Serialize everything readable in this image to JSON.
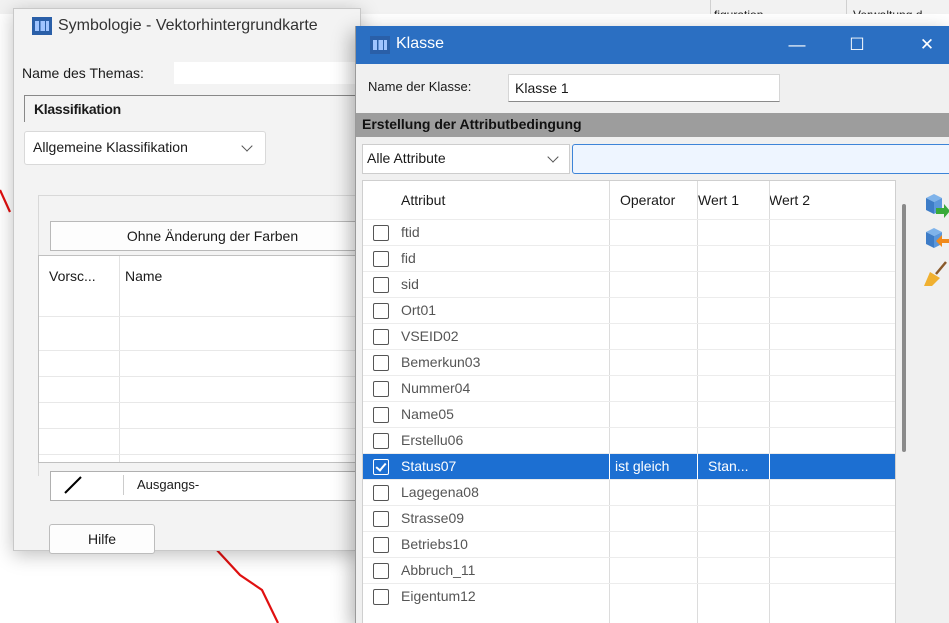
{
  "background": {
    "tab_partial_1": "figuration",
    "tab_partial_2": "Verwaltung d"
  },
  "symbology_window": {
    "title": "Symbologie - Vektorhintergrundkarte",
    "theme_label": "Name des Themas:",
    "classification_group": "Klassifikation",
    "classification_type": "Allgemeine Klassifikation",
    "color_button": "Ohne Änderung der Farben",
    "list_headers": [
      "Vorsc...",
      "Name"
    ],
    "symbol_label": "Ausgangs-",
    "help_button": "Hilfe"
  },
  "class_dialog": {
    "title": "Klasse",
    "name_label": "Name der Klasse:",
    "name_value": "Klasse 1",
    "section_title": "Erstellung der Attributbedingung",
    "attribute_filter": "Alle Attribute",
    "value_filter": "",
    "columns": [
      "Attribut",
      "Operator",
      "Wert 1",
      "Wert 2"
    ],
    "rows": [
      {
        "attr": "ftid",
        "op": "",
        "w1": "",
        "w2": "",
        "checked": false
      },
      {
        "attr": "fid",
        "op": "",
        "w1": "",
        "w2": "",
        "checked": false
      },
      {
        "attr": "sid",
        "op": "",
        "w1": "",
        "w2": "",
        "checked": false
      },
      {
        "attr": "Ort01",
        "op": "",
        "w1": "",
        "w2": "",
        "checked": false
      },
      {
        "attr": "VSEID02",
        "op": "",
        "w1": "",
        "w2": "",
        "checked": false
      },
      {
        "attr": "Bemerkun03",
        "op": "",
        "w1": "",
        "w2": "",
        "checked": false
      },
      {
        "attr": "Nummer04",
        "op": "",
        "w1": "",
        "w2": "",
        "checked": false
      },
      {
        "attr": "Name05",
        "op": "",
        "w1": "",
        "w2": "",
        "checked": false
      },
      {
        "attr": "Erstellu06",
        "op": "",
        "w1": "",
        "w2": "",
        "checked": false
      },
      {
        "attr": "Status07",
        "op": "ist gleich",
        "w1": "Stan...",
        "w2": "",
        "checked": true
      },
      {
        "attr": "Lagegena08",
        "op": "",
        "w1": "",
        "w2": "",
        "checked": false
      },
      {
        "attr": "Strasse09",
        "op": "",
        "w1": "",
        "w2": "",
        "checked": false
      },
      {
        "attr": "Betriebs10",
        "op": "",
        "w1": "",
        "w2": "",
        "checked": false
      },
      {
        "attr": "Abbruch_11",
        "op": "",
        "w1": "",
        "w2": "",
        "checked": false
      },
      {
        "attr": "Eigentum12",
        "op": "",
        "w1": "",
        "w2": "",
        "checked": false
      }
    ],
    "side_icons": [
      "import-icon",
      "export-icon",
      "clear-broom-icon"
    ],
    "colors": {
      "titlebar": "#2b6fc2",
      "selection": "#1c6fd2",
      "section": "#9d9d9d"
    }
  }
}
